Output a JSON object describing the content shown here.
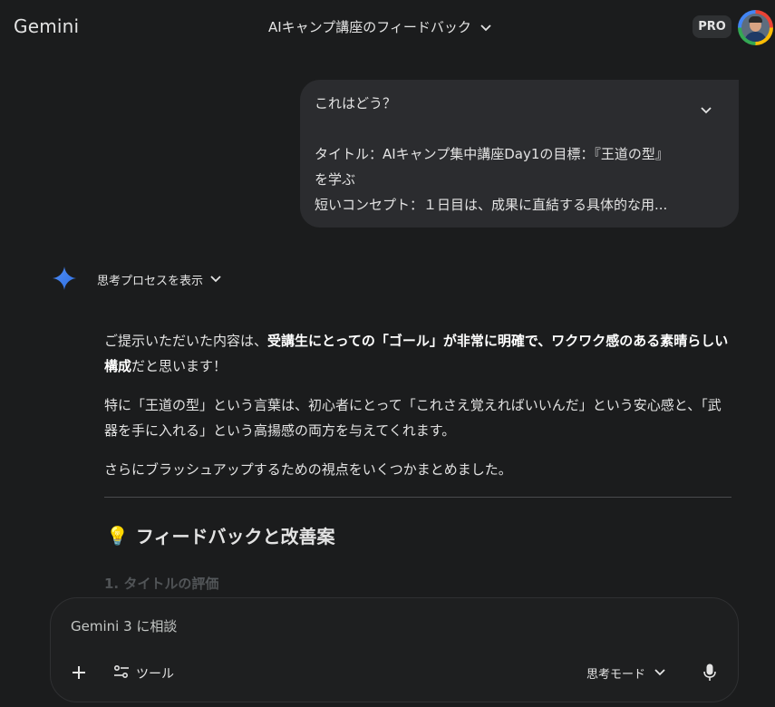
{
  "header": {
    "brand": "Gemini",
    "conversation_title": "AIキャンプ講座のフィードバック",
    "plan_badge": "PRO"
  },
  "user_message": {
    "line1": "これはどう？",
    "line2": "タイトル：AIキャンプ集中講座Day1の目標：『王道の型』",
    "line3": "を学ぶ",
    "line4": "短いコンセプト：１日目は、成果に直結する具体的な用..."
  },
  "response": {
    "thoughts_label": "思考プロセスを表示",
    "p1_a": "ご提示いただいた内容は、",
    "p1_b": "受講生にとっての「ゴール」が非常に明確で、ワクワク感のある素晴らしい構成",
    "p1_c": "だと思います！",
    "p2": "特に「王道の型」という言葉は、初心者にとって「これさえ覚えればいいんだ」という安心感と、「武器を手に入れる」という高揚感の両方を与えてくれます。",
    "p3": "さらにブラッシュアップするための視点をいくつかまとめました。",
    "section_emoji": "💡",
    "section_heading": "フィードバックと改善案",
    "subheading": "1. タイトルの評価"
  },
  "composer": {
    "placeholder": "Gemini 3 に相談",
    "value": "",
    "tools_label": "ツール",
    "mode_label": "思考モード"
  },
  "colors": {
    "background": "#1b1c1d",
    "bubble": "#2b2c2f",
    "composer": "#1e1f20",
    "text": "#e3e3e3",
    "spark_blue": "#4285f4"
  },
  "icons": {
    "title_dropdown": "chevron-down-icon",
    "bubble_expand": "chevron-down-icon",
    "gemini": "gemini-spark-icon",
    "thoughts_toggle": "chevron-down-icon",
    "add": "plus-icon",
    "tools": "tune-icon",
    "mode": "chevron-down-icon",
    "mic": "microphone-icon"
  }
}
